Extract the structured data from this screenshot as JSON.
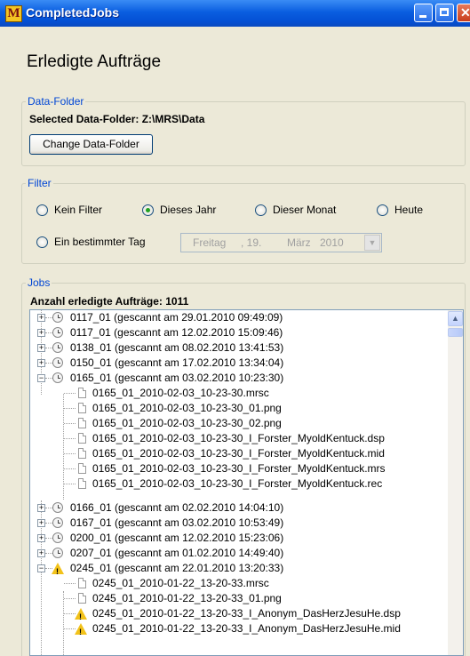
{
  "window": {
    "title": "CompletedJobs",
    "app_icon_letter": "M"
  },
  "heading": "Erledigte Aufträge",
  "data_folder": {
    "legend": "Data-Folder",
    "selected_label": "Selected Data-Folder: Z:\\MRS\\Data",
    "change_button": "Change Data-Folder"
  },
  "filter": {
    "legend": "Filter",
    "options": [
      {
        "label": "Kein Filter",
        "selected": false
      },
      {
        "label": "Dieses Jahr",
        "selected": true
      },
      {
        "label": "Dieser Monat",
        "selected": false
      },
      {
        "label": "Heute",
        "selected": false
      },
      {
        "label": "Ein bestimmter Tag",
        "selected": false
      }
    ],
    "date": {
      "weekday": "Freitag",
      "day": ", 19.",
      "month": "März",
      "year": "2010"
    }
  },
  "jobs": {
    "legend": "Jobs",
    "count_label": "Anzahl erledigte Aufträge: 1011",
    "tree": [
      {
        "label": "0117_01  (gescannt am 29.01.2010 09:49:09)",
        "expanded": false,
        "icon": "clock-icon"
      },
      {
        "label": "0117_01  (gescannt am 12.02.2010 15:09:46)",
        "expanded": false,
        "icon": "clock-icon"
      },
      {
        "label": "0138_01  (gescannt am 08.02.2010 13:41:53)",
        "expanded": false,
        "icon": "clock-icon"
      },
      {
        "label": "0150_01  (gescannt am 17.02.2010 13:34:04)",
        "expanded": false,
        "icon": "clock-icon"
      },
      {
        "label": "0165_01  (gescannt am 03.02.2010 10:23:30)",
        "expanded": true,
        "icon": "clock-icon",
        "children": [
          {
            "label": "0165_01_2010-02-03_10-23-30.mrsc",
            "icon": "document-icon"
          },
          {
            "label": "0165_01_2010-02-03_10-23-30_01.png",
            "icon": "document-icon"
          },
          {
            "label": "0165_01_2010-02-03_10-23-30_02.png",
            "icon": "document-icon"
          },
          {
            "label": "0165_01_2010-02-03_10-23-30_I_Forster_MyoldKentuck.dsp",
            "icon": "document-icon"
          },
          {
            "label": "0165_01_2010-02-03_10-23-30_I_Forster_MyoldKentuck.mid",
            "icon": "document-icon"
          },
          {
            "label": "0165_01_2010-02-03_10-23-30_I_Forster_MyoldKentuck.mrs",
            "icon": "document-icon"
          },
          {
            "label": "0165_01_2010-02-03_10-23-30_I_Forster_MyoldKentuck.rec",
            "icon": "document-icon"
          }
        ]
      },
      {
        "label": "0166_01  (gescannt am 02.02.2010 14:04:10)",
        "expanded": false,
        "icon": "clock-icon"
      },
      {
        "label": "0167_01  (gescannt am 03.02.2010 10:53:49)",
        "expanded": false,
        "icon": "clock-icon"
      },
      {
        "label": "0200_01  (gescannt am 12.02.2010 15:23:06)",
        "expanded": false,
        "icon": "clock-icon"
      },
      {
        "label": "0207_01  (gescannt am 01.02.2010 14:49:40)",
        "expanded": false,
        "icon": "clock-icon"
      },
      {
        "label": "0245_01  (gescannt am 22.01.2010 13:20:33)",
        "expanded": true,
        "icon": "warning-icon",
        "children": [
          {
            "label": "0245_01_2010-01-22_13-20-33.mrsc",
            "icon": "document-icon"
          },
          {
            "label": "0245_01_2010-01-22_13-20-33_01.png",
            "icon": "document-icon"
          },
          {
            "label": "0245_01_2010-01-22_13-20-33_I_Anonym_DasHerzJesuHe.dsp",
            "icon": "warning-icon"
          },
          {
            "label": "0245_01_2010-01-22_13-20-33_I_Anonym_DasHerzJesuHe.mid",
            "icon": "warning-icon"
          }
        ]
      }
    ]
  }
}
